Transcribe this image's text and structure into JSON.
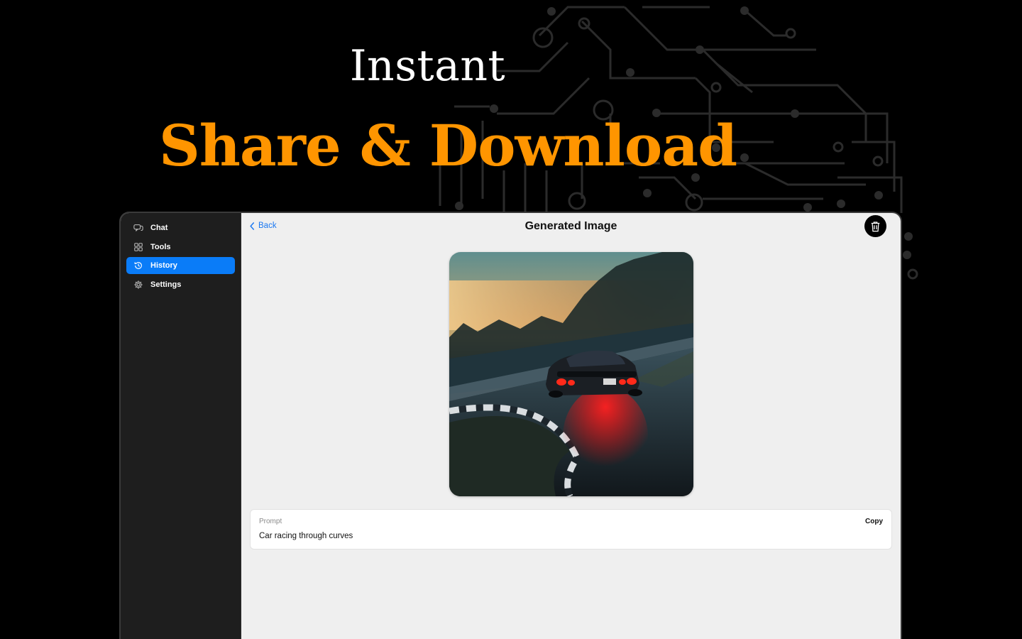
{
  "hero": {
    "line1": "Instant",
    "line2": "Share & Download",
    "accent_color": "#ff9500"
  },
  "sidebar": {
    "items": [
      {
        "label": "Chat",
        "icon": "chat-bubbles-icon",
        "active": false
      },
      {
        "label": "Tools",
        "icon": "grid-icon",
        "active": false
      },
      {
        "label": "History",
        "icon": "clock-history-icon",
        "active": true
      },
      {
        "label": "Settings",
        "icon": "gear-icon",
        "active": false
      }
    ],
    "active_color": "#0a7cf8"
  },
  "header": {
    "back_label": "Back",
    "title": "Generated Image",
    "delete_icon": "trash-icon"
  },
  "image": {
    "subject": "generated-image",
    "icon": "car-photo"
  },
  "prompt": {
    "label": "Prompt",
    "text": "Car racing through curves",
    "copy_label": "Copy"
  }
}
